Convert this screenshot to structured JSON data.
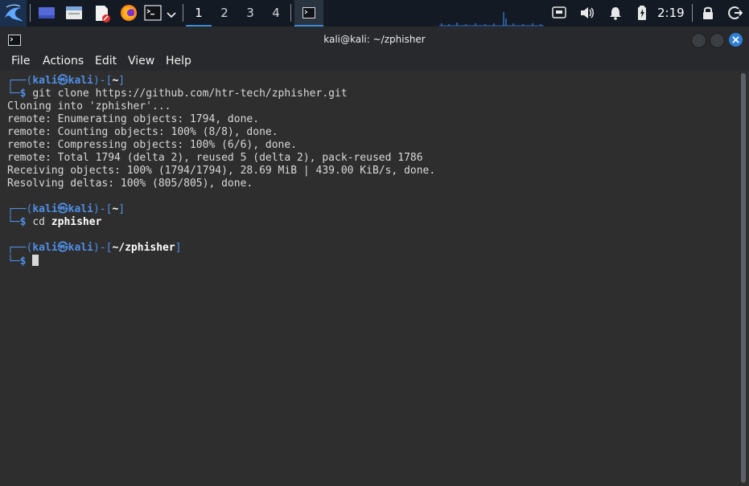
{
  "panel": {
    "workspaces": [
      "1",
      "2",
      "3",
      "4"
    ],
    "active_workspace": "1",
    "clock": "2:19",
    "launchers": [
      "kali-menu-icon",
      "show-desktop-icon",
      "file-manager-icon",
      "text-editor-icon",
      "firefox-icon",
      "terminal-icon",
      "chevron-down-icon"
    ],
    "tray": [
      "network-icon",
      "volume-icon",
      "notifications-icon",
      "battery-icon",
      "lock-icon",
      "logout-icon"
    ]
  },
  "window": {
    "title": "kali@kali: ~/zphisher"
  },
  "menubar": {
    "file": "File",
    "actions": "Actions",
    "edit": "Edit",
    "view": "View",
    "help": "Help"
  },
  "terminal": {
    "prompt1": {
      "user": "kali",
      "at": "㉿",
      "host": "kali",
      "dir": "~",
      "command": "git clone https://github.com/htr-tech/zphisher.git"
    },
    "output": [
      "Cloning into 'zphisher'...",
      "remote: Enumerating objects: 1794, done.",
      "remote: Counting objects: 100% (8/8), done.",
      "remote: Compressing objects: 100% (6/6), done.",
      "remote: Total 1794 (delta 2), reused 5 (delta 2), pack-reused 1786",
      "Receiving objects: 100% (1794/1794), 28.69 MiB | 439.00 KiB/s, done.",
      "Resolving deltas: 100% (805/805), done."
    ],
    "prompt2": {
      "user": "kali",
      "at": "㉿",
      "host": "kali",
      "dir": "~",
      "command_prefix": "cd ",
      "command_arg": "zphisher"
    },
    "prompt3": {
      "user": "kali",
      "at": "㉿",
      "host": "kali",
      "dir": "~/zphisher"
    },
    "prompt_symbol": "$"
  },
  "colors": {
    "accent": "#3d8bd6",
    "prompt_blue": "#4f8fe6",
    "close_button": "#2f7fd8"
  }
}
